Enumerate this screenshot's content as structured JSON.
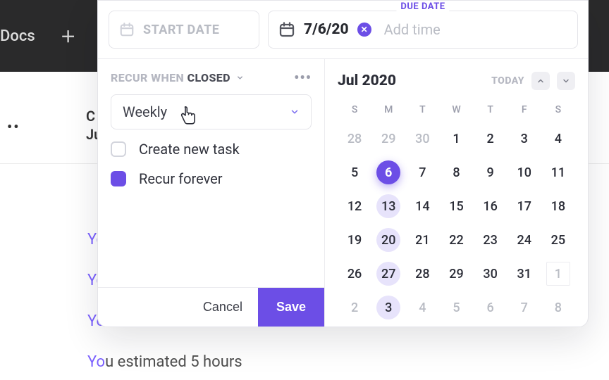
{
  "background": {
    "docs": "Docs",
    "c_letter": "C",
    "ju_letters": "Ju",
    "you": "Yo",
    "you_full": "Yo",
    "estimated_line": "estimated 5 hours"
  },
  "modal": {
    "start": {
      "placeholder": "START DATE"
    },
    "due": {
      "label": "DUE DATE",
      "value": "7/6/20",
      "add_time": "Add time"
    },
    "recur": {
      "label_prefix": "RECUR WHEN",
      "label_state": "CLOSED",
      "frequency": "Weekly",
      "opt_create": "Create new task",
      "opt_forever": "Recur forever"
    },
    "footer": {
      "cancel": "Cancel",
      "save": "Save"
    },
    "calendar": {
      "month": "Jul 2020",
      "today": "TODAY",
      "dow": [
        "S",
        "M",
        "T",
        "W",
        "T",
        "F",
        "S"
      ],
      "days": [
        {
          "n": "28",
          "other": true
        },
        {
          "n": "29",
          "other": true
        },
        {
          "n": "30",
          "other": true
        },
        {
          "n": "1"
        },
        {
          "n": "2"
        },
        {
          "n": "3"
        },
        {
          "n": "4"
        },
        {
          "n": "5"
        },
        {
          "n": "6",
          "selected": true
        },
        {
          "n": "7"
        },
        {
          "n": "8"
        },
        {
          "n": "9"
        },
        {
          "n": "10"
        },
        {
          "n": "11"
        },
        {
          "n": "12"
        },
        {
          "n": "13",
          "highlight": true
        },
        {
          "n": "14"
        },
        {
          "n": "15"
        },
        {
          "n": "16"
        },
        {
          "n": "17"
        },
        {
          "n": "18"
        },
        {
          "n": "19"
        },
        {
          "n": "20",
          "highlight": true
        },
        {
          "n": "21"
        },
        {
          "n": "22"
        },
        {
          "n": "23"
        },
        {
          "n": "24"
        },
        {
          "n": "25"
        },
        {
          "n": "26"
        },
        {
          "n": "27",
          "highlight": true
        },
        {
          "n": "28"
        },
        {
          "n": "29"
        },
        {
          "n": "30"
        },
        {
          "n": "31"
        },
        {
          "n": "1",
          "other": true,
          "boxed": true
        },
        {
          "n": "2",
          "other": true
        },
        {
          "n": "3",
          "other": true,
          "highlight": true
        },
        {
          "n": "4",
          "other": true
        },
        {
          "n": "5",
          "other": true
        },
        {
          "n": "6",
          "other": true
        },
        {
          "n": "7",
          "other": true
        },
        {
          "n": "8",
          "other": true
        }
      ]
    }
  }
}
